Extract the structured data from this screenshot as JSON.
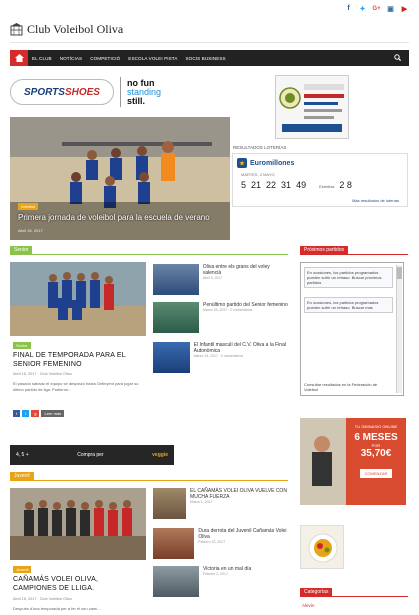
{
  "social": {
    "icons": [
      "facebook-icon",
      "twitter-icon",
      "google-plus-icon",
      "instagram-icon",
      "youtube-icon"
    ],
    "glyphs": [
      "f",
      "y",
      "G+",
      "▣",
      "▶"
    ],
    "colors": [
      "#3b5998",
      "#1da1f2",
      "#dd4b39",
      "#3f729b",
      "#cd201f"
    ]
  },
  "header": {
    "site_title": "Club Voleibol Oliva"
  },
  "nav": {
    "items": [
      "EL CLUB",
      "NOTÍCIAS",
      "COMPETICIÓ",
      "ESCOLA VOLEI PISTA",
      "SOCIS BUSINESS"
    ]
  },
  "sponsor": {
    "brand_a": "SPORTS",
    "brand_b": "SHOES",
    "tag_1": "no fun",
    "tag_2": "standing",
    "tag_3": "still."
  },
  "hero": {
    "category": "Voleibol",
    "title": "Primera jornada de voleibol para la escuela de verano",
    "meta": "Abril 18, 2017"
  },
  "lottery": {
    "results_title": "RESULTADOS LOTERÍAS",
    "name": "Euromillones",
    "date": "MARTES, 2 MAYO",
    "numbers": [
      "5",
      "21",
      "22",
      "31",
      "49"
    ],
    "stars_label": "Estrellas",
    "stars": "2 8",
    "more_link": "Más resultados de loterías"
  },
  "senior": {
    "label": "Senior",
    "main_title": "FINAL DE TEMPORADA PARA EL SENIOR FEMENINO",
    "main_category": "Senior",
    "main_meta": "Abril 18, 2017 · Club Voleibol Oliva",
    "main_excerpt": "El pasado sábado el equipo se desplazó hasta Ontinyent para jugar su último partido de liga. Pudieron...",
    "read_more": "Leer más",
    "side": [
      {
        "title": "Oliva entre els grans del voley valencià",
        "meta": "Abril 3, 2017"
      },
      {
        "title": "Penúltimo partido del Senior femenino",
        "meta": "Marzo 25, 2017 · 0 comentarios"
      },
      {
        "title": "El Infantil masculí del C.V. Oliva a la Final Autonòmica",
        "meta": "Marzo 19, 2017 · 0 comentarios"
      }
    ]
  },
  "banner": {
    "left": "4, 5 +",
    "mid": "Compra per",
    "right": "veggie"
  },
  "juvenil": {
    "label": "Juvenil",
    "main_category": "Juvenil",
    "main_title": "CAÑAMÁS VOLEI OLIVA, CAMPIONES DE LLIGA.",
    "main_meta": "Abril 18, 2017 · Club Voleibol Oliva",
    "main_excerpt": "Después d'una temporada per a fer el seu camí...",
    "side": [
      {
        "title": "EL CAÑAMÁS VOLEI OLIVA VUELVE CON MUCHA FUERZA",
        "meta": "Marzo 1, 2017"
      },
      {
        "title": "Dura derrota del Juvenil Cañamás Volei Oliva",
        "meta": "Febrero 22, 2017"
      },
      {
        "title": "Victoria en un mal día",
        "meta": "Febrero 2, 2017"
      }
    ]
  },
  "sidebar": {
    "matches_label": "Próximos partidos",
    "match_1": "En ocasiones, los partidos programados pueden sufrir un retraso. Buscar próximos partidos",
    "match_2": "En ocasiones, los partidos programados pueden sufrir un retraso. Buscar más",
    "match_footer": "Consultar resultados en la Federación de Voleibol",
    "gym_top": "TU GIMNASIO ONLINE",
    "gym_big": "6 MESES",
    "gym_por": "POR",
    "gym_price": "35,70€",
    "gym_cta": "COMENZAR",
    "categories_label": "Categorías",
    "categories_first": "Alevín"
  }
}
